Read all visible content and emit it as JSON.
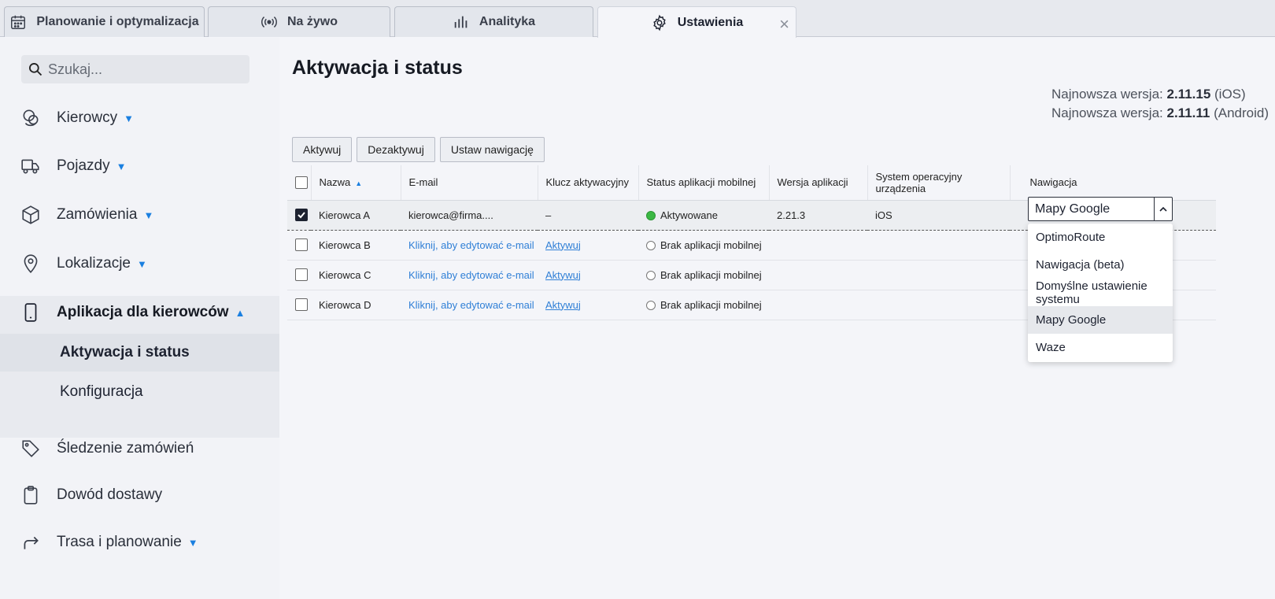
{
  "tabs": [
    {
      "label": "Planowanie i optymalizacja",
      "icon": "calendar-icon"
    },
    {
      "label": "Na żywo",
      "icon": "broadcast-icon"
    },
    {
      "label": "Analityka",
      "icon": "bar-chart-icon"
    },
    {
      "label": "Ustawienia",
      "icon": "gear-icon",
      "active": true
    }
  ],
  "sidebar": {
    "search_placeholder": "Szukaj...",
    "items": [
      {
        "label": "Kierowcy",
        "icon": "drivers-icon"
      },
      {
        "label": "Pojazdy",
        "icon": "truck-icon"
      },
      {
        "label": "Zamówienia",
        "icon": "box-icon"
      },
      {
        "label": "Lokalizacje",
        "icon": "location-pin-icon"
      },
      {
        "label": "Aplikacja dla kierowców",
        "icon": "phone-icon",
        "expanded": true
      },
      {
        "label": "Śledzenie zamówień",
        "icon": "tag-icon"
      },
      {
        "label": "Dowód dostawy",
        "icon": "clipboard-icon"
      },
      {
        "label": "Trasa i planowanie",
        "icon": "route-arrow-icon"
      }
    ],
    "subitems": [
      {
        "label": "Aktywacja i status",
        "active": true
      },
      {
        "label": "Konfiguracja"
      }
    ]
  },
  "main": {
    "title": "Aktywacja i status",
    "version_ios_label": "Najnowsza wersja:",
    "version_ios": "2.11.15",
    "version_ios_platform": "(iOS)",
    "version_android_label": "Najnowsza wersja:",
    "version_android": "2.11.11",
    "version_android_platform": "(Android)",
    "buttons": {
      "activate": "Aktywuj",
      "deactivate": "Dezaktywuj",
      "set_nav": "Ustaw nawigację"
    },
    "columns": [
      "Nazwa",
      "E-mail",
      "Klucz aktywacyjny",
      "Status aplikacji mobilnej",
      "Wersja aplikacji",
      "System operacyjny urządzenia",
      "Nawigacja"
    ],
    "rows": [
      {
        "name": "Kierowca A",
        "email": "kierowca@firma....",
        "key": "–",
        "status": "Aktywowane",
        "version": "2.21.3",
        "os": "iOS",
        "checked": true
      },
      {
        "name": "Kierowca B",
        "email": "Kliknij, aby edytować e-mail",
        "key": "Aktywuj",
        "status": "Brak aplikacji mobilnej",
        "version": "",
        "os": ""
      },
      {
        "name": "Kierowca C",
        "email": "Kliknij, aby edytować e-mail",
        "key": "Aktywuj",
        "status": "Brak aplikacji mobilnej",
        "version": "",
        "os": ""
      },
      {
        "name": "Kierowca D",
        "email": "Kliknij, aby edytować e-mail",
        "key": "Aktywuj",
        "status": "Brak aplikacji mobilnej",
        "version": "",
        "os": ""
      }
    ],
    "nav_select": {
      "value": "Mapy Google",
      "options": [
        "OptimoRoute",
        "Nawigacja (beta)",
        "Domyślne ustawienie systemu",
        "Mapy Google",
        "Waze"
      ]
    }
  },
  "colors": {
    "accent": "#1a7fe0",
    "link": "#2f7fd6",
    "active_status": "#3bb843"
  }
}
